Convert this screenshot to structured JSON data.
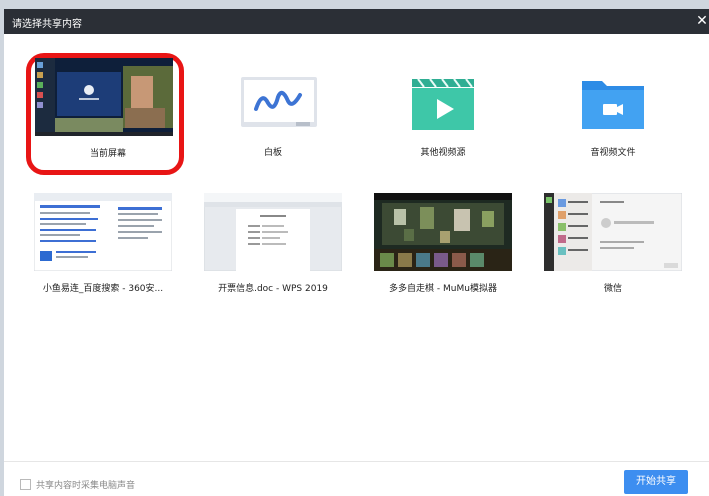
{
  "window": {
    "title": "请选择共享内容",
    "close_glyph": "✕"
  },
  "tiles": [
    {
      "label": "当前屏幕",
      "icon": "desktop-screenshot-thumbnail",
      "selected": true
    },
    {
      "label": "白板",
      "icon": "whiteboard-icon"
    },
    {
      "label": "其他视频源",
      "icon": "video-clapper-icon"
    },
    {
      "label": "音视频文件",
      "icon": "video-folder-icon"
    },
    {
      "label": "小鱼易连_百度搜索 - 360安...",
      "icon": "browser-window-thumbnail"
    },
    {
      "label": "开票信息.doc - WPS 2019",
      "icon": "wps-document-thumbnail"
    },
    {
      "label": "多多自走棋 - MuMu模拟器",
      "icon": "game-window-thumbnail"
    },
    {
      "label": "微信",
      "icon": "wechat-window-thumbnail"
    }
  ],
  "footer": {
    "checkbox_label": "共享内容时采集电脑声音",
    "checkbox_checked": false,
    "start_label": "开始共享"
  },
  "colors": {
    "titlebar": "#2b2f36",
    "accent": "#3d8ef0",
    "selection": "#e81515",
    "teal": "#3ec7a8"
  }
}
